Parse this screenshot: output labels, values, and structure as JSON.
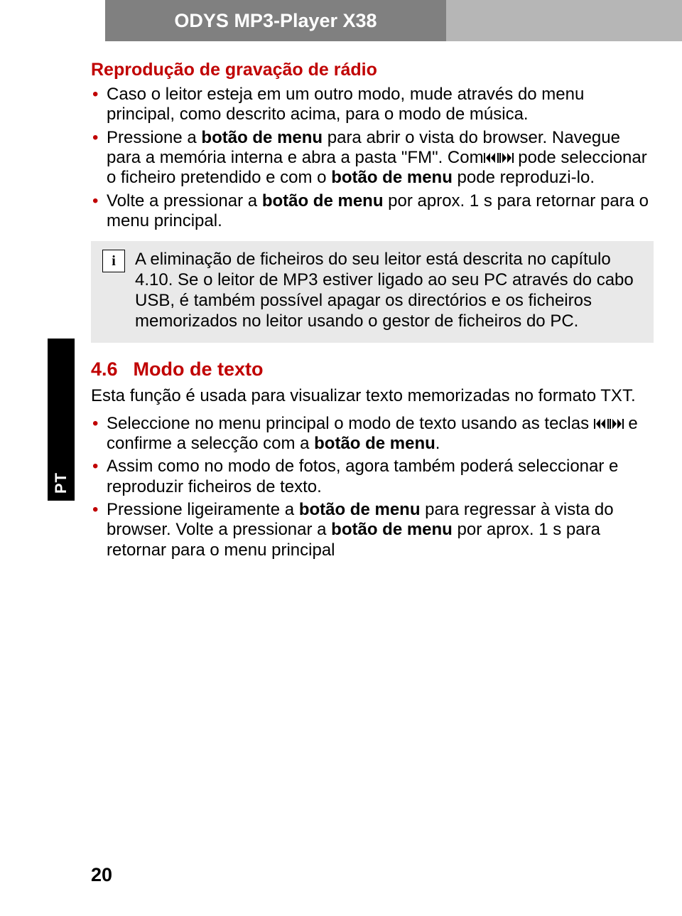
{
  "header": {
    "title": "ODYS MP3-Player X38"
  },
  "lang_tab": "PT",
  "page_number": "20",
  "sec_radio": {
    "title": "Reprodução de gravação de rádio",
    "b1": "Caso o leitor esteja em um outro modo, mude através do menu principal, como descrito acima, para o modo de música.",
    "b2a": "Pressione a ",
    "b2b": "botão de menu",
    "b2c": " para abrir o vista do browser. Navegue para a memória interna e abra a pasta \"FM\". Com",
    "b2d": " pode seleccionar o ficheiro pretendido e com o ",
    "b2e": "botão de menu",
    "b2f": " pode reproduzi-lo.",
    "b3a": "Volte a pressionar a ",
    "b3b": "botão de menu",
    "b3c": " por aprox. 1 s para retornar para o menu principal."
  },
  "info": {
    "text": "A eliminação de ficheiros do seu leitor está descrita no capítulo 4.10. Se o leitor de MP3 estiver ligado ao seu PC através do cabo USB, é também possível apagar os directórios e os ficheiros memorizados no leitor usando o gestor de ficheiros do PC."
  },
  "sec46": {
    "num": "4.6",
    "title": "Modo de texto",
    "intro": "Esta função é usada para visualizar texto memorizadas no formato TXT.",
    "b1a": "Seleccione no menu principal o modo de texto usando as teclas ",
    "b1b": " e confirme a selecção com a ",
    "b1c": "botão de menu",
    "b1d": ".",
    "b2": "Assim como no modo de fotos, agora também poderá seleccionar e reproduzir ficheiros de texto.",
    "b3a": "Pressione ligeiramente a ",
    "b3b": "botão de menu",
    "b3c": " para regressar à vista do browser. Volte a pressionar a ",
    "b3d": "botão de menu",
    "b3e": " por aprox. 1 s para retornar para o menu principal"
  }
}
